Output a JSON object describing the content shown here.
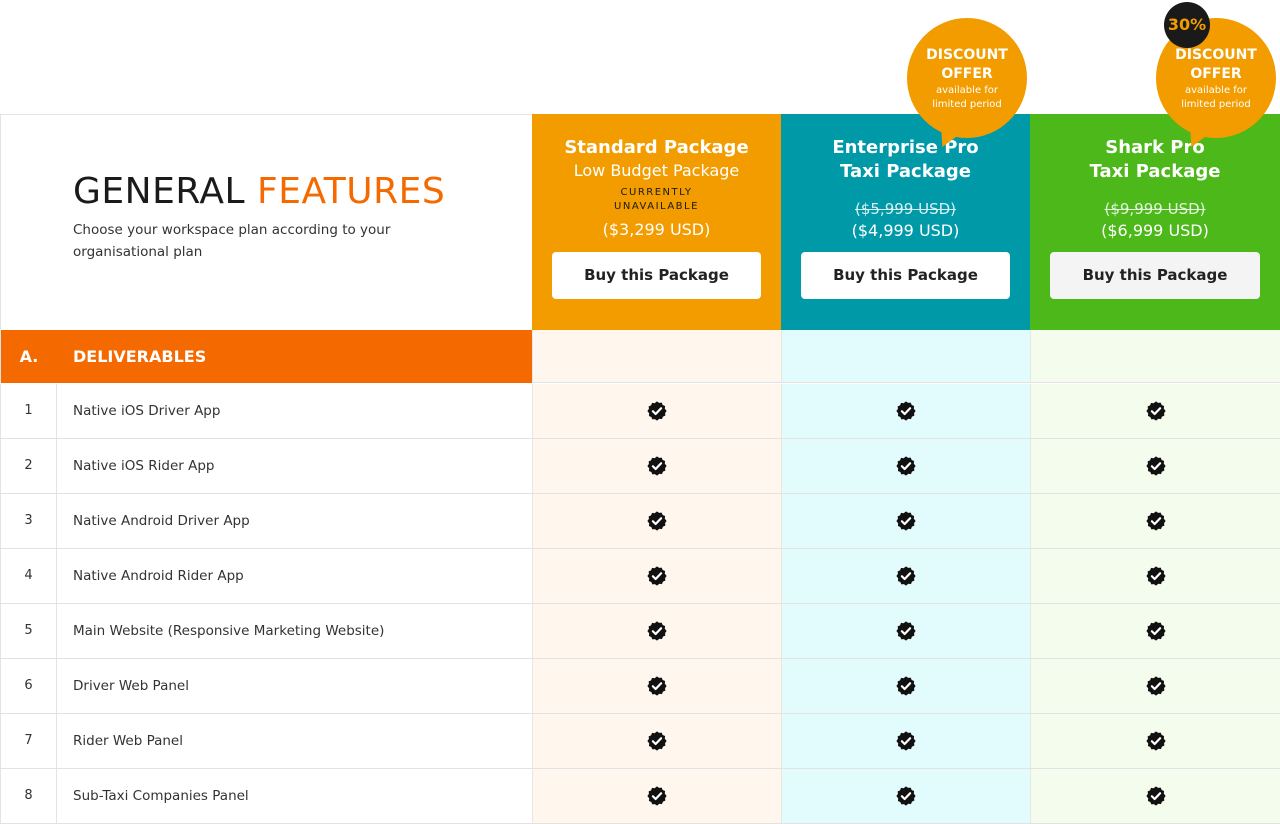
{
  "general": {
    "title_1": "GENERAL",
    "title_2": "FEATURES",
    "subtitle": "Choose your workspace plan according to your organisational plan"
  },
  "packages": [
    {
      "name_1": "Standard Package",
      "name_2": "Low Budget Package",
      "status": "CURRENTLY UNAVAILABLE",
      "old_price": "",
      "price": "($3,299 USD)",
      "buy_label": "Buy this Package",
      "color": "#f29c00"
    },
    {
      "name_1": "Enterprise Pro",
      "name_2": "Taxi Package",
      "status": "",
      "old_price": "($5,999 USD)",
      "price": "($4,999 USD)",
      "buy_label": "Buy this Package",
      "color": "#0099a8",
      "badge": {
        "line_1": "DISCOUNT",
        "line_2": "OFFER",
        "line_3": "available for",
        "line_4": "limited period"
      }
    },
    {
      "name_1": "Shark Pro",
      "name_2": "Taxi Package",
      "status": "",
      "old_price": "($9,999 USD)",
      "price": "($6,999 USD)",
      "buy_label": "Buy this Package",
      "color": "#4cb81a",
      "badge": {
        "line_1": "DISCOUNT",
        "line_2": "OFFER",
        "line_3": "available for",
        "line_4": "limited period",
        "percent": "30%"
      }
    }
  ],
  "section": {
    "number": "A.",
    "title": "DELIVERABLES"
  },
  "features": [
    {
      "num": "1",
      "name": "Native iOS Driver App",
      "standard": true,
      "enterprise": true,
      "shark": true
    },
    {
      "num": "2",
      "name": "Native iOS Rider App",
      "standard": true,
      "enterprise": true,
      "shark": true
    },
    {
      "num": "3",
      "name": "Native Android Driver App",
      "standard": true,
      "enterprise": true,
      "shark": true
    },
    {
      "num": "4",
      "name": "Native Android Rider App",
      "standard": true,
      "enterprise": true,
      "shark": true
    },
    {
      "num": "5",
      "name": "Main Website (Responsive Marketing Website)",
      "standard": true,
      "enterprise": true,
      "shark": true
    },
    {
      "num": "6",
      "name": "Driver Web Panel",
      "standard": true,
      "enterprise": true,
      "shark": true
    },
    {
      "num": "7",
      "name": "Rider Web Panel",
      "standard": true,
      "enterprise": true,
      "shark": true
    },
    {
      "num": "8",
      "name": "Sub-Taxi Companies Panel",
      "standard": true,
      "enterprise": true,
      "shark": true
    }
  ],
  "icons": {
    "check": "verified-check-icon"
  }
}
